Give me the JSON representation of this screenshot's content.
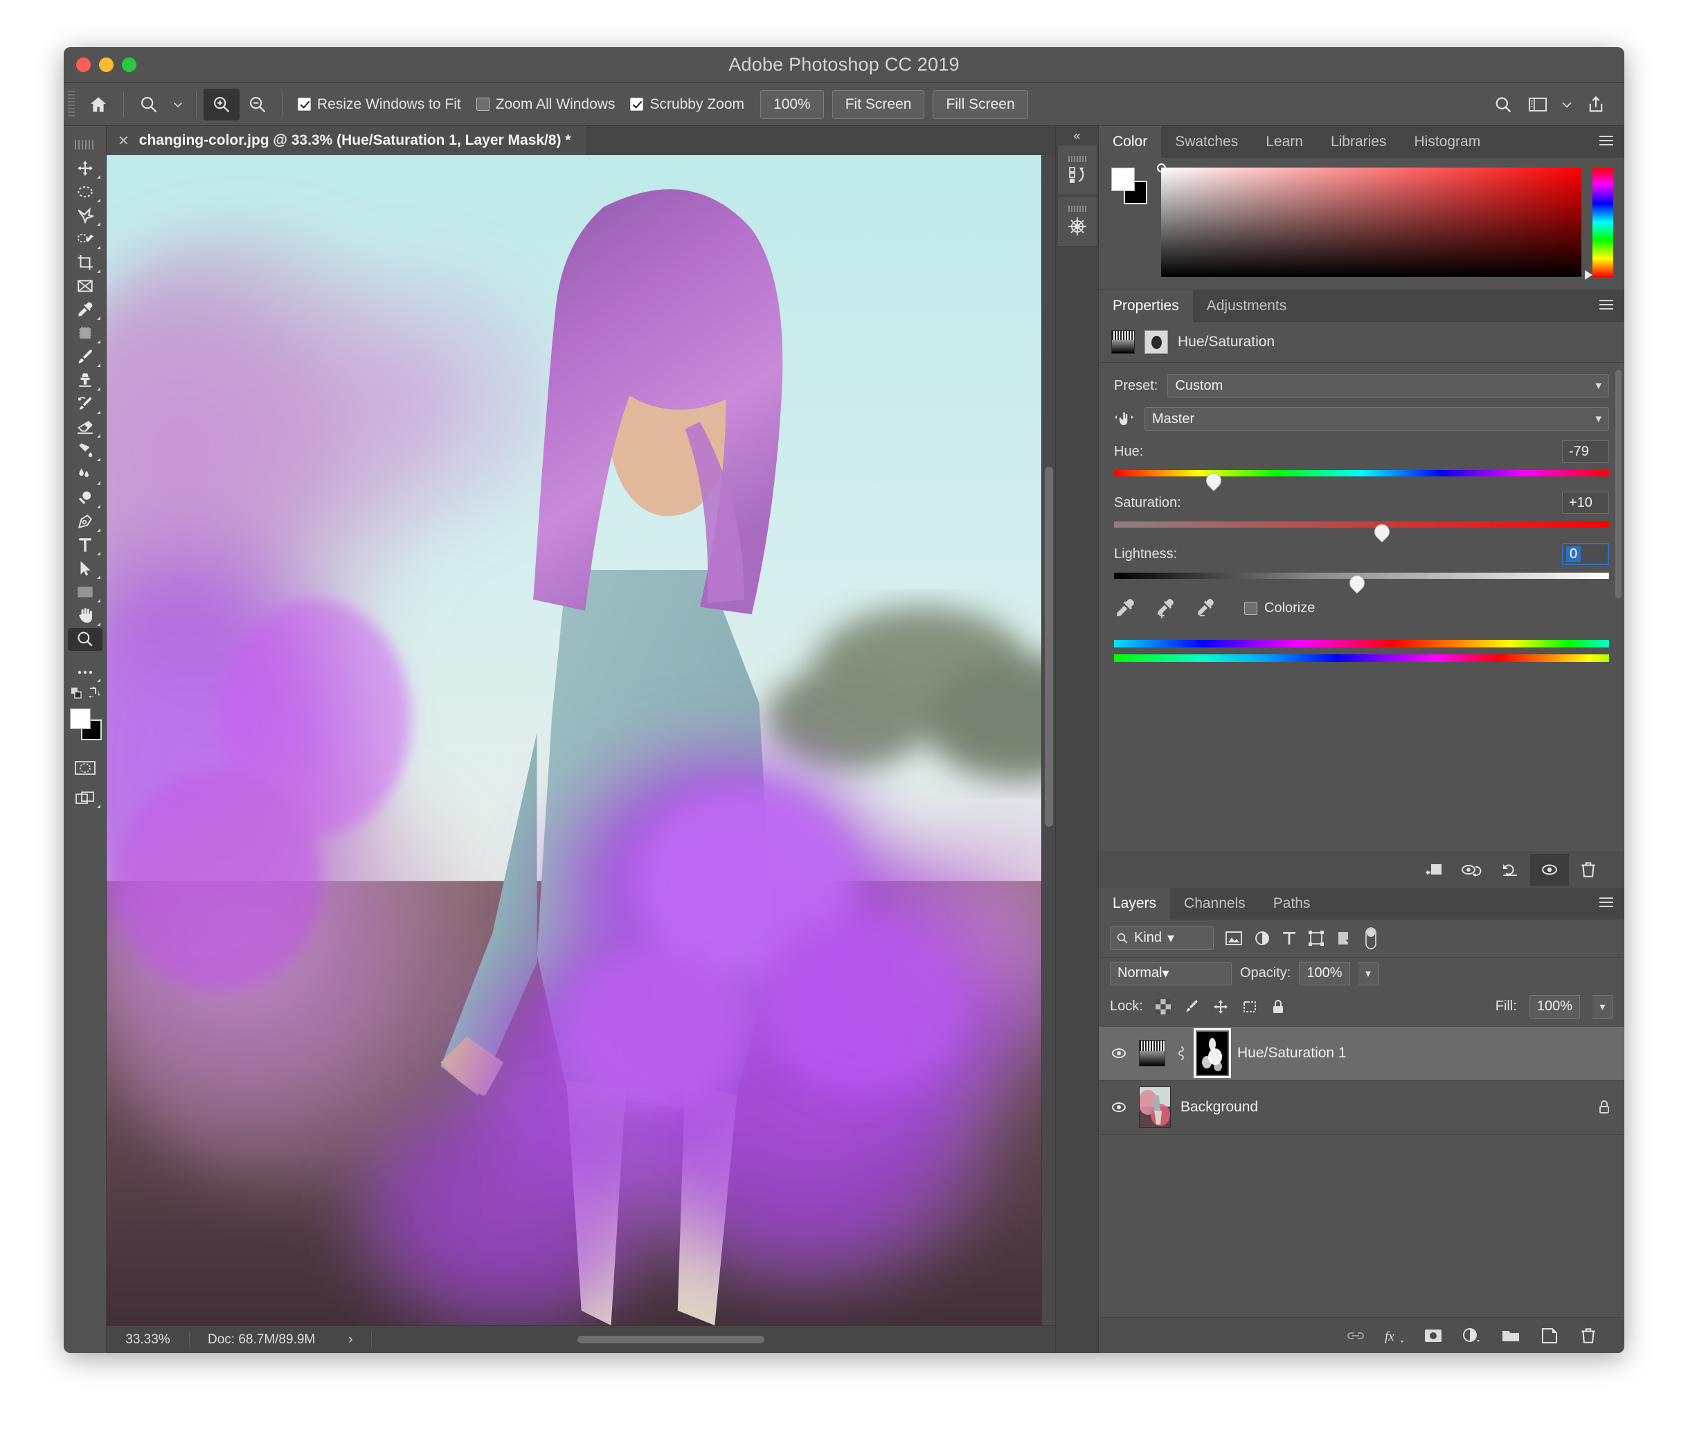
{
  "window": {
    "title": "Adobe Photoshop CC 2019",
    "traffic": [
      "close",
      "minimize",
      "maximize"
    ]
  },
  "options_bar": {
    "home_icon": "home-icon",
    "tool_icon": "zoom-tool-icon",
    "tool_chevron": "chevron-down-icon",
    "zoom_in_icon": "zoom-in-icon",
    "zoom_out_icon": "zoom-out-icon",
    "checkboxes": [
      {
        "label": "Resize Windows to Fit",
        "checked": true
      },
      {
        "label": "Zoom All Windows",
        "checked": false
      },
      {
        "label": "Scrubby Zoom",
        "checked": true
      }
    ],
    "buttons": [
      "100%",
      "Fit Screen",
      "Fill Screen"
    ],
    "right_icons": [
      "search-icon",
      "workspace-icon",
      "chevron-down-icon",
      "share-icon"
    ]
  },
  "toolbox": {
    "tools": [
      "move-tool",
      "marquee-tool",
      "lasso-tool",
      "quick-selection-tool",
      "crop-tool",
      "frame-tool",
      "eyedropper-tool",
      "healing-brush-tool",
      "brush-tool",
      "clone-stamp-tool",
      "history-brush-tool",
      "eraser-tool",
      "gradient-tool",
      "blur-tool",
      "dodge-tool",
      "pen-tool",
      "type-tool",
      "path-selection-tool",
      "rectangle-tool",
      "hand-tool",
      "zoom-tool"
    ],
    "selected_tool": "zoom-tool",
    "more_tools": "more-tools-icon",
    "foreground_color": "#ffffff",
    "background_color": "#000000",
    "quick_mask": "quick-mask-icon",
    "screen_mode": "screen-mode-icon"
  },
  "document": {
    "tab_title": "changing-color.jpg @ 33.3% (Hue/Saturation 1, Layer Mask/8) *",
    "close_icon": "close-icon"
  },
  "status_bar": {
    "zoom": "33.33%",
    "doc_info": "Doc: 68.7M/89.9M",
    "expand_icon": "chevron-right-icon"
  },
  "rail": {
    "collapse_icon": "collapse-panels-icon",
    "items": [
      "history-panel-icon",
      "navigator-panel-icon"
    ]
  },
  "color_panel": {
    "tabs": [
      "Color",
      "Swatches",
      "Learn",
      "Libraries",
      "Histogram"
    ],
    "active_tab": "Color",
    "menu_icon": "panel-menu-icon",
    "foreground_color": "#ffffff",
    "background_color": "#000000"
  },
  "properties_panel": {
    "tabs": [
      "Properties",
      "Adjustments"
    ],
    "active_tab": "Properties",
    "menu_icon": "panel-menu-icon",
    "header_title": "Hue/Saturation",
    "preset_label": "Preset:",
    "preset_value": "Custom",
    "channel_value": "Master",
    "targeted_adjustment_icon": "targeted-adjustment-icon",
    "sliders": [
      {
        "label": "Hue:",
        "value": "-79",
        "position_pct": 28,
        "focused": false
      },
      {
        "label": "Saturation:",
        "value": "+10",
        "position_pct": 55,
        "focused": false
      },
      {
        "label": "Lightness:",
        "value": "0",
        "position_pct": 49,
        "focused": true
      }
    ],
    "eyedroppers": [
      "eyedropper-icon",
      "eyedropper-add-icon",
      "eyedropper-subtract-icon"
    ],
    "colorize_label": "Colorize",
    "colorize_checked": false,
    "footer_icons": [
      "clip-to-layer-icon",
      "toggle-preview-icon",
      "reset-icon",
      "visibility-eye-icon",
      "delete-icon"
    ]
  },
  "layers_panel": {
    "tabs": [
      "Layers",
      "Channels",
      "Paths"
    ],
    "active_tab": "Layers",
    "menu_icon": "panel-menu-icon",
    "filter": {
      "kind_label": "Kind",
      "search_icon": "search-icon",
      "type_filters": [
        "pixel-filter-icon",
        "adjustment-filter-icon",
        "text-filter-icon",
        "shape-filter-icon",
        "smart-object-filter-icon"
      ],
      "toggle": "filter-toggle-icon"
    },
    "blend_mode": "Normal",
    "opacity_label": "Opacity:",
    "opacity_value": "100%",
    "lock_label": "Lock:",
    "lock_icons": [
      "lock-transparency-icon",
      "lock-image-icon",
      "lock-position-icon",
      "lock-artboard-icon",
      "lock-all-icon"
    ],
    "fill_label": "Fill:",
    "fill_value": "100%",
    "layers": [
      {
        "name": "Hue/Saturation 1",
        "visible": true,
        "selected": true,
        "type": "adjustment",
        "has_mask": true,
        "locked": false
      },
      {
        "name": "Background",
        "visible": true,
        "selected": false,
        "type": "image",
        "has_mask": false,
        "locked": true
      }
    ],
    "footer_icons": [
      "link-layers-icon",
      "layer-style-icon",
      "add-mask-icon",
      "new-adjustment-icon",
      "new-group-icon",
      "new-layer-icon",
      "delete-layer-icon"
    ]
  }
}
